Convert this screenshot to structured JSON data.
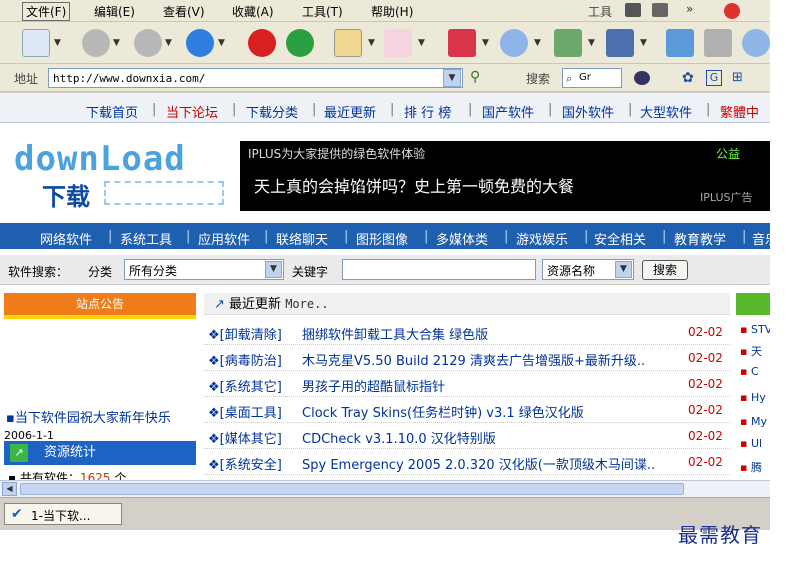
{
  "menu": {
    "items": [
      {
        "label": "文件(F)"
      },
      {
        "label": "编辑(E)"
      },
      {
        "label": "查看(V)"
      },
      {
        "label": "收藏(A)"
      },
      {
        "label": "工具(T)"
      },
      {
        "label": "帮助(H)"
      }
    ],
    "tools_label": "工具"
  },
  "address": {
    "label": "地址",
    "url": "http://www.downxia.com/",
    "search_label": "搜索",
    "search_value": "Gr"
  },
  "topnav": [
    "下载首页",
    "当下论坛",
    "下载分类",
    "最近更新",
    "排 行 榜",
    "国产软件",
    "国外软件",
    "大型软件",
    "繁體中"
  ],
  "logo": {
    "word": "downLoad",
    "cn": "下载"
  },
  "banner": {
    "top_text": "IPLUS为大家提供的绿色软件体验",
    "green_text": "公益",
    "main_text": "天上真的会掉馅饼吗？史上第一顿免费的大餐",
    "corner_text": "IPLUS广告"
  },
  "catnav": [
    "网络软件",
    "系统工具",
    "应用软件",
    "联络聊天",
    "图形图像",
    "多媒体类",
    "游戏娱乐",
    "安全相关",
    "教育教学",
    "音乐"
  ],
  "search": {
    "label": "软件搜索：",
    "category_label": "分类",
    "category_value": "所有分类",
    "keyword_label": "关键字",
    "field_value": "资源名称",
    "button_label": "搜索"
  },
  "notice": {
    "title": "站点公告",
    "text": "当下软件园祝大家新年快乐",
    "date": "2006-1-1"
  },
  "stats": {
    "title": "资源统计",
    "total_label": "共有软件：",
    "total_value": "1625",
    "unit": "个"
  },
  "list": {
    "title": "最近更新",
    "more": "More..",
    "rows": [
      {
        "category": "[卸载清除]",
        "title": "捆绑软件卸载工具大合集 绿色版",
        "date": "02-02"
      },
      {
        "category": "[病毒防治]",
        "title": "木马克星V5.50 Build 2129 清爽去广告增强版+最新升级..",
        "date": "02-02"
      },
      {
        "category": "[系统其它]",
        "title": "男孩子用的超酷鼠标指针",
        "date": "02-02"
      },
      {
        "category": "[桌面工具]",
        "title": "Clock Tray Skins(任务栏时钟) v3.1 绿色汉化版",
        "date": "02-02"
      },
      {
        "category": "[媒体其它]",
        "title": "CDCheck v3.1.10.0 汉化特别版",
        "date": "02-02"
      },
      {
        "category": "[系统安全]",
        "title": "Spy Emergency 2005 2.0.320 汉化版(一款顶级木马间谍..",
        "date": "02-02"
      }
    ]
  },
  "rightcol": [
    "STV",
    "天",
    "C",
    "Hy",
    "My m",
    "Ul",
    "腾"
  ],
  "tab": {
    "label": "1-当下软..."
  },
  "watermark": "最需教育",
  "colors": {
    "accent_blue": "#1f5fb0",
    "link_blue": "#003399",
    "date_red": "#cc0000",
    "notice_orange": "#f07d1a"
  }
}
